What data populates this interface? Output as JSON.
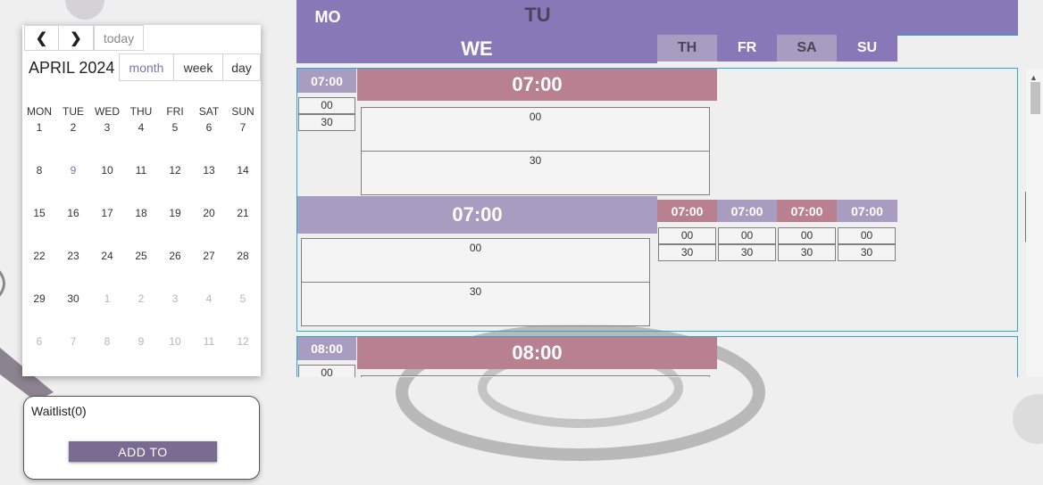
{
  "mini_calendar": {
    "prev_icon": "chevron-left-icon",
    "next_icon": "chevron-right-icon",
    "today_label": "today",
    "title": "APRIL 2024",
    "views": [
      "month",
      "week",
      "day"
    ],
    "active_view": "month",
    "weekdays": [
      "MON",
      "TUE",
      "WED",
      "THU",
      "FRI",
      "SAT",
      "SUN"
    ],
    "weeks": [
      [
        "1",
        "2",
        "3",
        "4",
        "5",
        "6",
        "7"
      ],
      [
        "8",
        "9",
        "10",
        "11",
        "12",
        "13",
        "14"
      ],
      [
        "15",
        "16",
        "17",
        "18",
        "19",
        "20",
        "21"
      ],
      [
        "22",
        "23",
        "24",
        "25",
        "26",
        "27",
        "28"
      ],
      [
        "29",
        "30",
        "1",
        "2",
        "3",
        "4",
        "5"
      ],
      [
        "6",
        "7",
        "8",
        "9",
        "10",
        "11",
        "12"
      ]
    ],
    "today": "9"
  },
  "waitlist": {
    "label": "Waitlist(0)",
    "button": "ADD TO"
  },
  "week_view": {
    "days": {
      "mo": "MO",
      "tu": "TU",
      "we": "WE",
      "th": "TH",
      "fr": "FR",
      "sa": "SA",
      "su": "SU"
    },
    "blocks": [
      {
        "mo_time": "07:00",
        "mo_slots": [
          "00",
          "30"
        ],
        "tu_time": "07:00",
        "tu_slots": [
          "00",
          "30"
        ],
        "we_time": "07:00",
        "we_slots": [
          "00",
          "30"
        ],
        "th_time": "07:00",
        "th_slots": [
          "00",
          "30"
        ],
        "fr_time": "07:00",
        "fr_slots": [
          "00",
          "30"
        ],
        "sa_time": "07:00",
        "sa_slots": [
          "00",
          "30"
        ],
        "su_time": "07:00",
        "su_slots": [
          "00",
          "30"
        ]
      },
      {
        "mo_time": "08:00",
        "mo_slots": [
          "00"
        ],
        "tu_time": "08:00"
      }
    ]
  },
  "colors": {
    "header_purple": "#8978b8",
    "light_purple": "#a89cc0",
    "rose": "#b9818f",
    "accent_blue": "#29a8d6",
    "button_purple": "#7a6b93"
  }
}
